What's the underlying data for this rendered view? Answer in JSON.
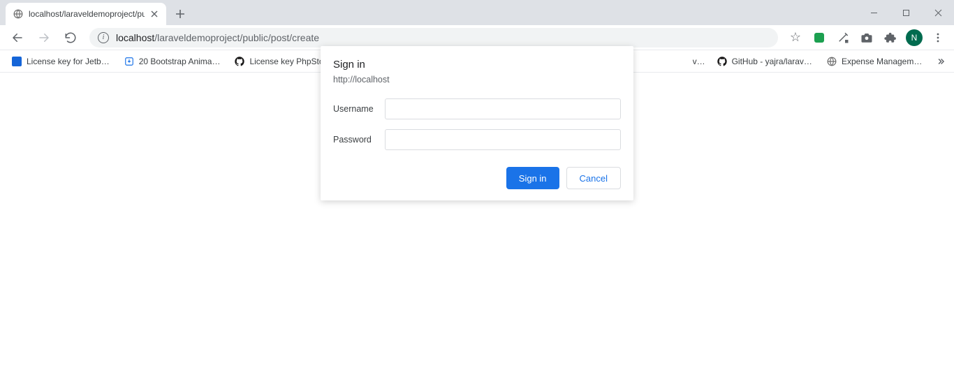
{
  "window": {
    "tab_title": "localhost/laraveldemoproject/pu"
  },
  "toolbar": {
    "url_host": "localhost",
    "url_path": "/laraveldemoproject/public/post/create",
    "profile_initial": "N"
  },
  "bookmarks": [
    {
      "label": "License key for Jetb…",
      "icon": "blue-square"
    },
    {
      "label": "20 Bootstrap Anima…",
      "icon": "blue-download"
    },
    {
      "label": "License key PhpStor…",
      "icon": "github"
    },
    {
      "label": "GitHub - yajra/larav…",
      "icon": "github"
    },
    {
      "label": "Expense Managem…",
      "icon": "globe"
    }
  ],
  "dialog": {
    "title": "Sign in",
    "origin": "http://localhost",
    "username_label": "Username",
    "password_label": "Password",
    "signin_btn": "Sign in",
    "cancel_btn": "Cancel"
  }
}
